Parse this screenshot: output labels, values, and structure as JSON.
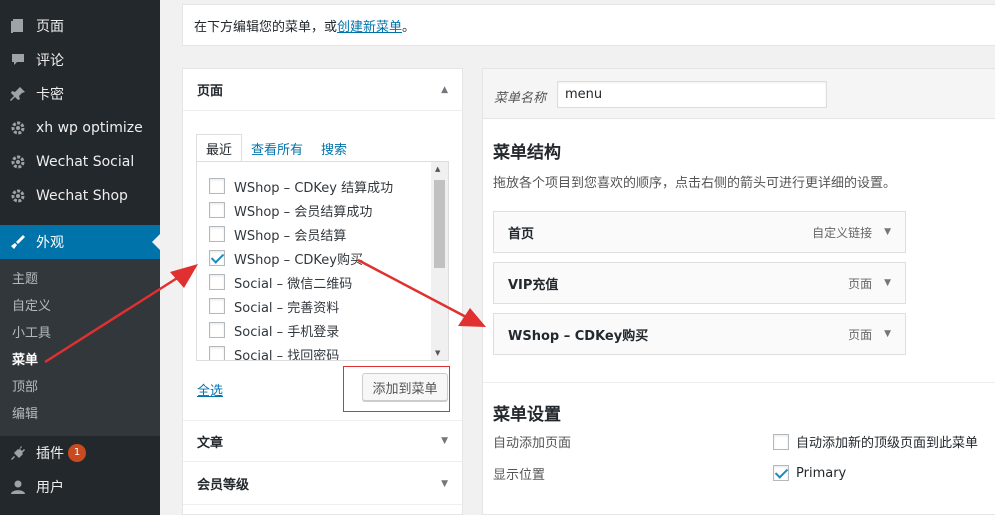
{
  "sidebar": {
    "items": [
      {
        "label": "页面",
        "icon": "pages-icon"
      },
      {
        "label": "评论",
        "icon": "comments-icon"
      },
      {
        "label": "卡密",
        "icon": "pin-icon"
      },
      {
        "label": "xh wp optimize",
        "icon": "gear-icon"
      },
      {
        "label": "Wechat Social",
        "icon": "gear-icon"
      },
      {
        "label": "Wechat Shop",
        "icon": "gear-icon"
      },
      {
        "label": "外观",
        "icon": "appearance-icon"
      },
      {
        "label": "插件",
        "icon": "plugins-icon",
        "badge": "1"
      },
      {
        "label": "用户",
        "icon": "users-icon"
      }
    ],
    "submenu": [
      "主题",
      "自定义",
      "小工具",
      "菜单",
      "顶部",
      "编辑"
    ]
  },
  "notice": {
    "text": "在下方编辑您的菜单，或",
    "link": "创建新菜单",
    "suffix": "。"
  },
  "left": {
    "pages_title": "页面",
    "tabs": [
      "最近",
      "查看所有",
      "搜索"
    ],
    "items": [
      {
        "label": "WShop – CDKey 结算成功",
        "checked": false
      },
      {
        "label": "WShop – 会员结算成功",
        "checked": false
      },
      {
        "label": "WShop – 会员结算",
        "checked": false
      },
      {
        "label": "WShop – CDKey购买",
        "checked": true
      },
      {
        "label": "Social – 微信二维码",
        "checked": false
      },
      {
        "label": "Social – 完善资料",
        "checked": false
      },
      {
        "label": "Social – 手机登录",
        "checked": false
      },
      {
        "label": "Social – 找回密码",
        "checked": false
      }
    ],
    "select_all": "全选",
    "add_button": "添加到菜单",
    "posts_title": "文章",
    "levels_title": "会员等级"
  },
  "right": {
    "name_label": "菜单名称",
    "name_value": "menu",
    "structure_title": "菜单结构",
    "structure_desc": "拖放各个项目到您喜欢的顺序，点击右侧的箭头可进行更详细的设置。",
    "menu_items": [
      {
        "label": "首页",
        "type": "自定义链接"
      },
      {
        "label": "VIP充值",
        "type": "页面"
      },
      {
        "label": "WShop – CDKey购买",
        "type": "页面"
      }
    ],
    "settings_title": "菜单设置",
    "auto_add_label": "自动添加页面",
    "auto_add_option": "自动添加新的顶级页面到此菜单",
    "auto_add_checked": false,
    "location_label": "显示位置",
    "location_option": "Primary",
    "location_checked": true
  },
  "colors": {
    "accent": "#0073aa",
    "annotation": "#e0302f"
  }
}
